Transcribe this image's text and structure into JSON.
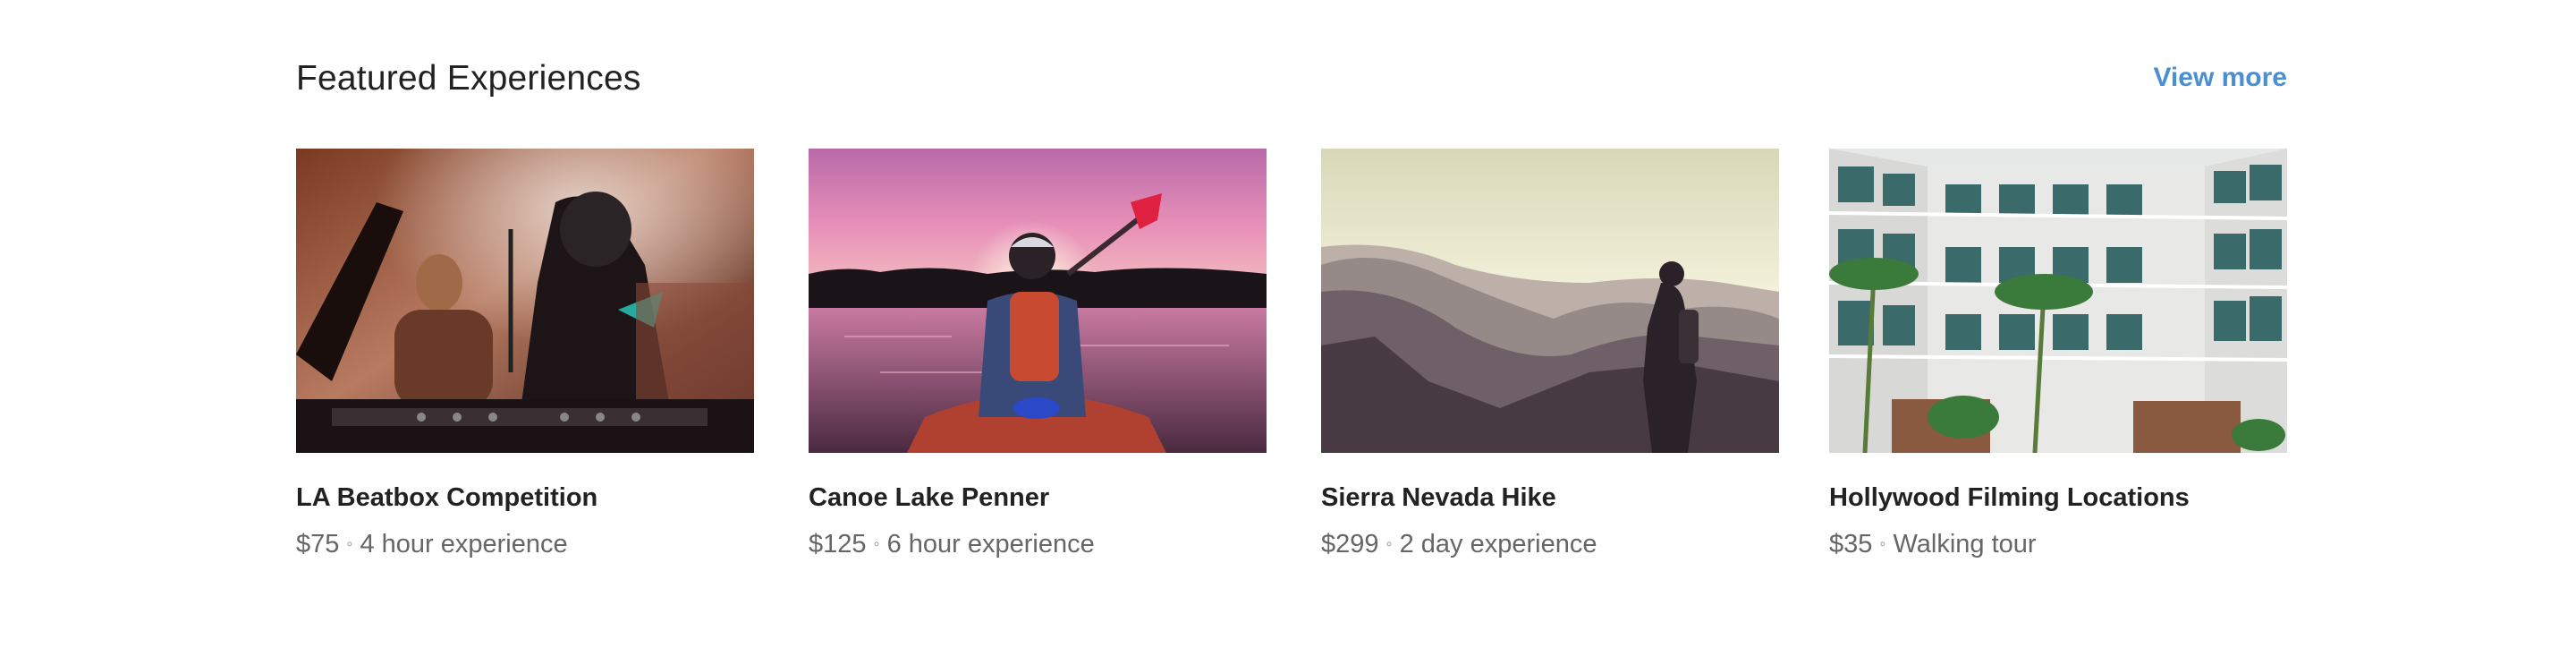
{
  "section": {
    "title": "Featured Experiences",
    "view_more_label": "View more",
    "accent_color": "#4a8fd4"
  },
  "cards": [
    {
      "title": "LA Beatbox Competition",
      "price": "$75",
      "separator": "◦",
      "detail": "4 hour experience",
      "image": "dj-concert-photo"
    },
    {
      "title": "Canoe Lake Penner",
      "price": "$125",
      "separator": "◦",
      "detail": "6 hour experience",
      "image": "kayak-sunset-photo"
    },
    {
      "title": "Sierra Nevada Hike",
      "price": "$299",
      "separator": "◦",
      "detail": "2 day experience",
      "image": "mountain-hiker-photo"
    },
    {
      "title": "Hollywood Filming Locations",
      "price": "$35",
      "separator": "◦",
      "detail": "Walking tour",
      "image": "hotel-courtyard-photo"
    }
  ]
}
